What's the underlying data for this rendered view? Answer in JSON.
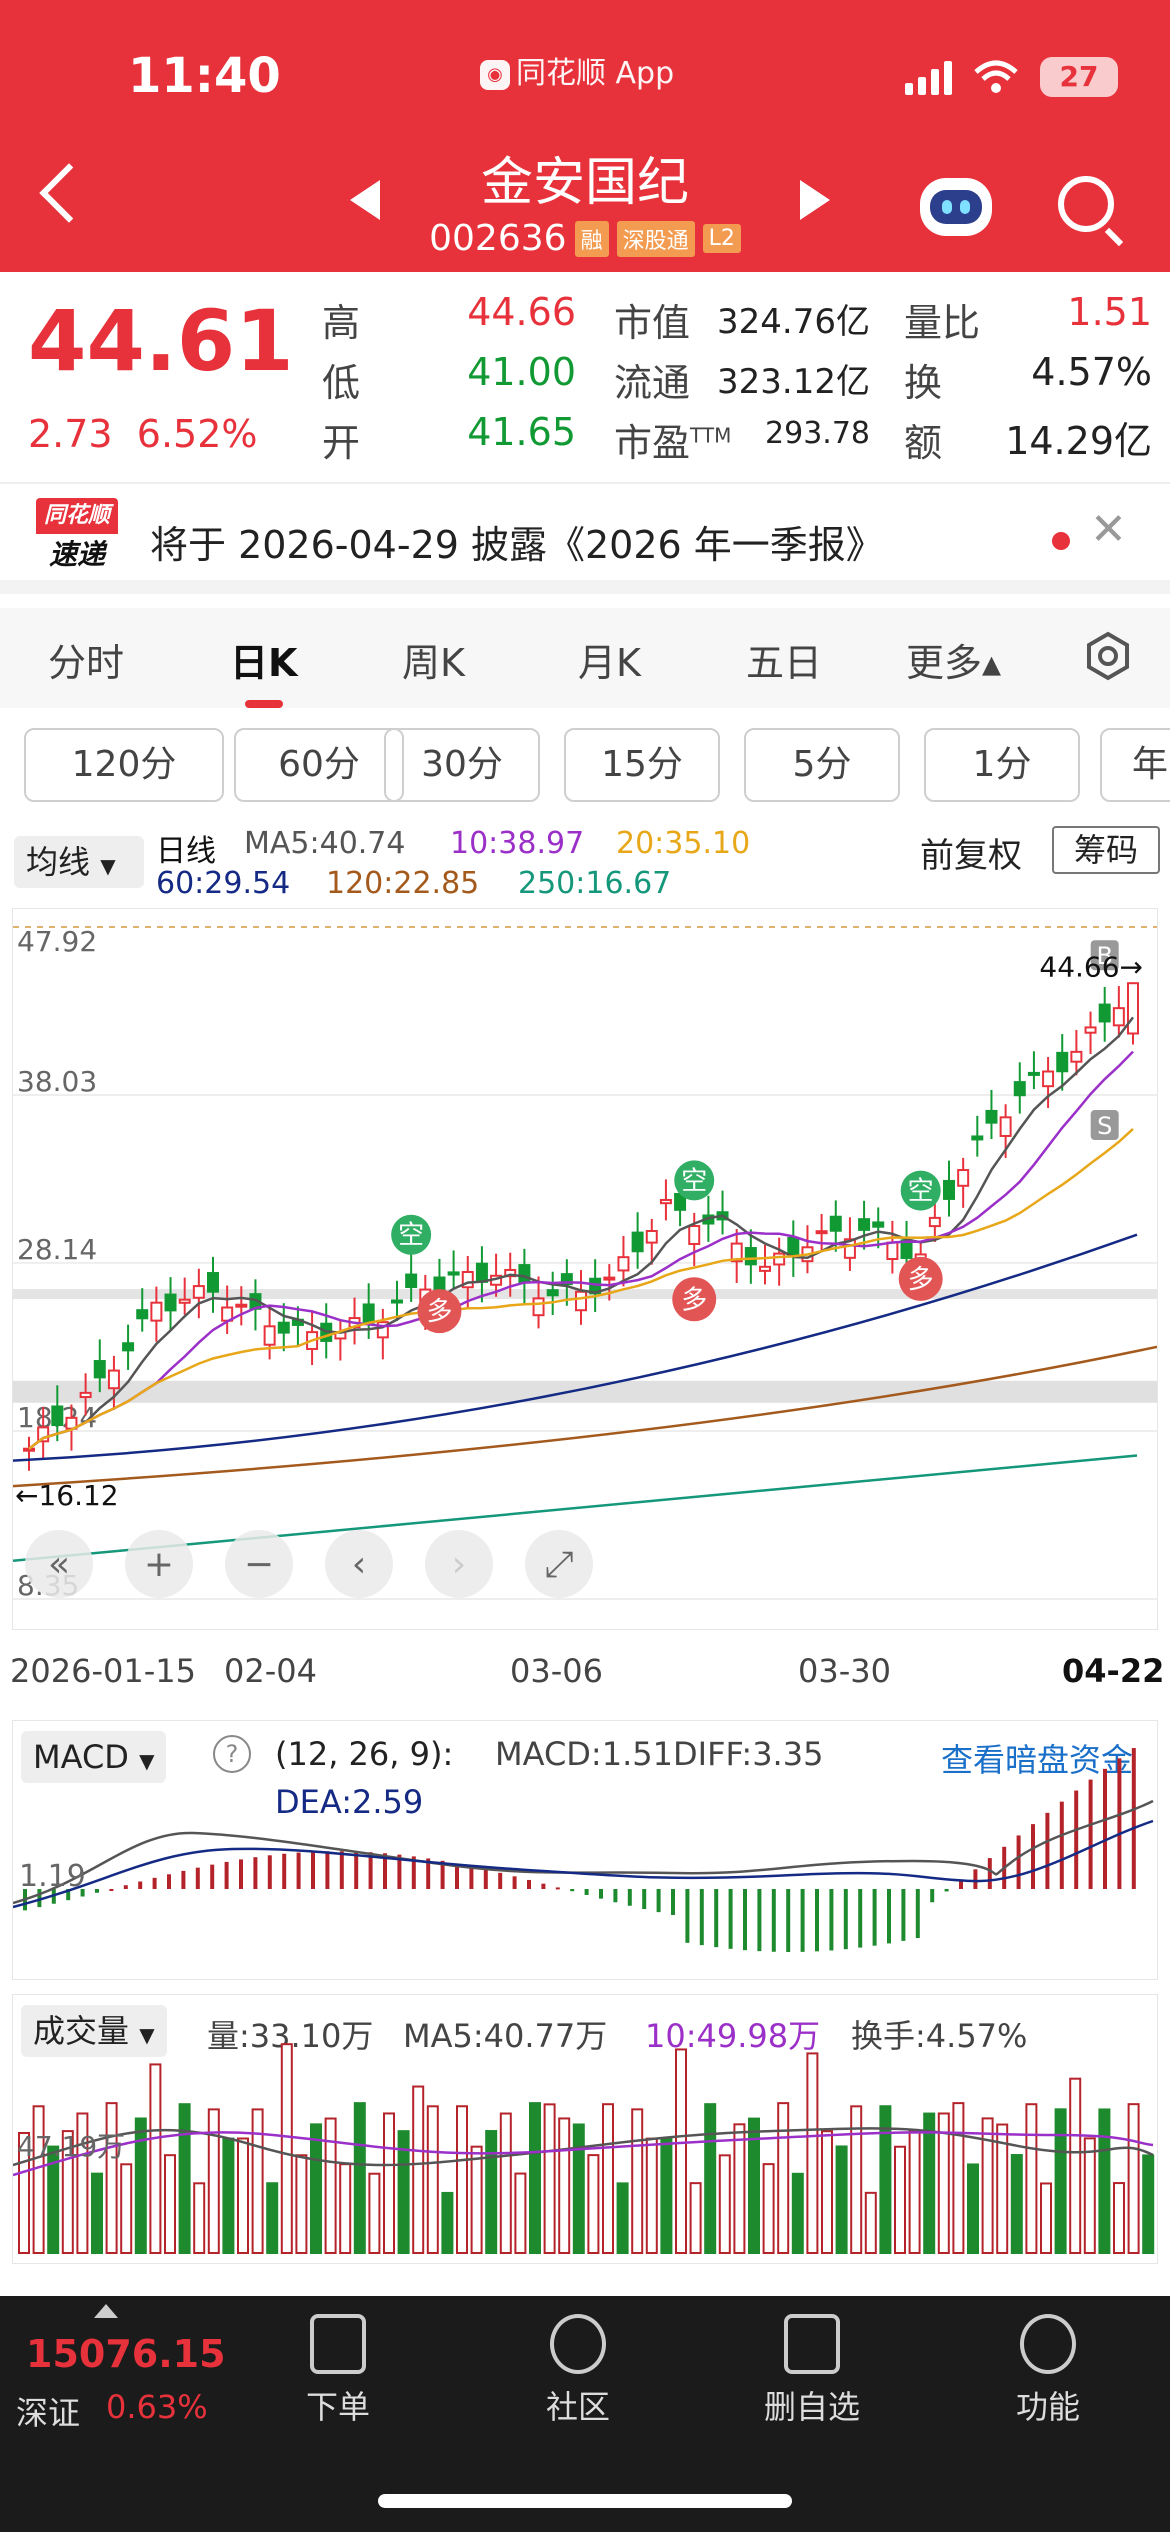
{
  "status": {
    "time": "11:40",
    "app": "同花顺 App",
    "battery": "27"
  },
  "stock": {
    "name": "金安国纪",
    "code": "002636",
    "tags": [
      "融",
      "深股通",
      "L2"
    ]
  },
  "quote": {
    "price": "44.61",
    "change": "2.73",
    "change_pct": "6.52%",
    "high_label": "高",
    "high": "44.66",
    "low_label": "低",
    "low": "41.00",
    "open_label": "开",
    "open": "41.65",
    "mcap_label": "市值",
    "mcap": "324.76亿",
    "float_label": "流通",
    "float": "323.12亿",
    "pe_label": "市盈",
    "pe_sup": "TTM",
    "pe": "293.78",
    "vr_label": "量比",
    "vr": "1.51",
    "turnover_label": "换",
    "turnover": "4.57%",
    "amount_label": "额",
    "amount": "14.29亿"
  },
  "notice": {
    "logo_top": "同花顺",
    "logo_bottom": "速递",
    "text": "将于 2026-04-29 披露《2026 年一季报》"
  },
  "tabs": [
    "分时",
    "日K",
    "周K",
    "月K",
    "五日",
    "更多▴"
  ],
  "periods": [
    "120分",
    "60分",
    "30分",
    "15分",
    "5分",
    "1分",
    "年"
  ],
  "ma": {
    "button": "均线",
    "daily": "日线",
    "ma5": "MA5:40.74",
    "ma10": "10:38.97",
    "ma20": "20:35.10",
    "ma60": "60:29.54",
    "ma120": "120:22.85",
    "ma250": "250:16.67",
    "fuquan": "前复权",
    "chouma": "筹码"
  },
  "kchart": {
    "y_labels": [
      "47.92",
      "38.03",
      "28.14",
      "18.24",
      "8.35"
    ],
    "high_marker": "44.66→",
    "low_marker": "←16.12",
    "dates": [
      "2026-01-15",
      "02-04",
      "03-06",
      "03-30",
      "04-22"
    ],
    "badges": {
      "kong": "空",
      "duo": "多",
      "b": "B",
      "s": "S"
    },
    "controls": [
      "«",
      "+",
      "−",
      "‹",
      "›",
      "⤢"
    ]
  },
  "macd": {
    "button": "MACD",
    "help": "?",
    "params": "(12, 26, 9):",
    "macd": "MACD:1.51",
    "diff": "DIFF:3.35",
    "dea": "DEA:2.59",
    "link": "查看暗盘资金",
    "y_label": "1.19"
  },
  "volume": {
    "button": "成交量",
    "vol": "量:33.10万",
    "ma5": "MA5:40.77万",
    "ma10": "10:49.98万",
    "turnover": "换手:4.57%",
    "y_label": "47.19万"
  },
  "bottom": {
    "index_value": "15076.15",
    "index_name": "深证",
    "index_pct": "0.63%",
    "nav": [
      "下单",
      "社区",
      "删自选",
      "功能"
    ]
  },
  "colors": {
    "up": "#e8323b",
    "down": "#119933",
    "header": "#e8323b"
  },
  "chart_data": {
    "type": "candlestick",
    "ylim": [
      8.35,
      47.92
    ],
    "x_start": "2026-01-15",
    "x_end": "2026-04-22",
    "y_ticks": [
      47.92,
      38.03,
      28.14,
      18.24,
      8.35
    ],
    "last": {
      "open": 41.65,
      "high": 44.66,
      "low": 41.0,
      "close": 44.61
    },
    "period_low": 16.12,
    "period_high": 44.66
  }
}
